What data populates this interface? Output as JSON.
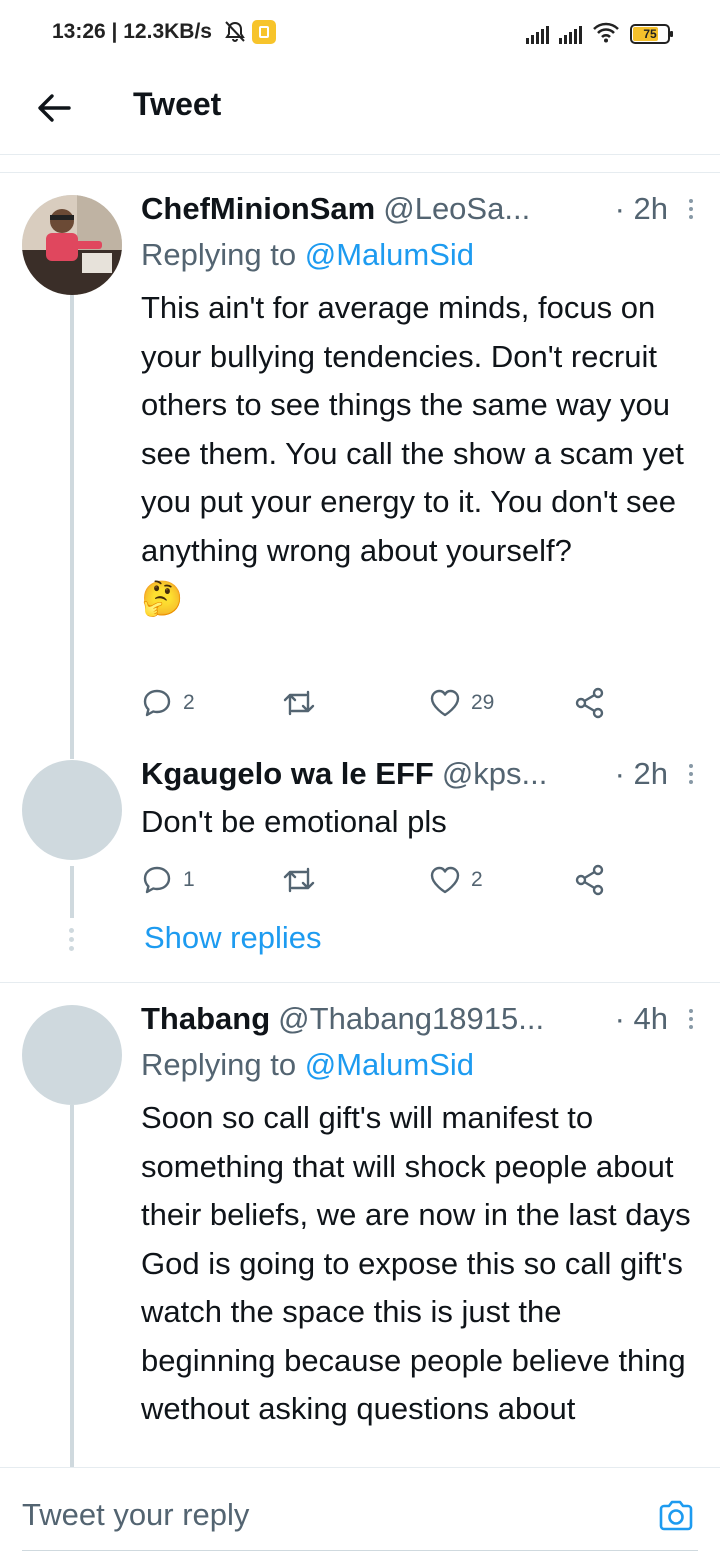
{
  "status_bar": {
    "time_speed": "13:26 | 12.3KB/s",
    "battery": "75",
    "icons": [
      "mute-icon",
      "app-notification-icon",
      "signal-icon",
      "wifi-icon",
      "battery-icon"
    ]
  },
  "header": {
    "title": "Tweet",
    "back_icon": "back-arrow-icon"
  },
  "tweets": [
    {
      "display_name": "ChefMinionSam",
      "handle": "@LeoSa...",
      "time": "· 2h",
      "replying_prefix": "Replying to",
      "replying_to": "@MalumSid",
      "text": "This ain't for average minds, focus on your bullying tendencies. Don't recruit others to see things the same way you see them. You call the show a scam yet you put your energy to it. You don't see anything wrong about yourself?",
      "emoji": "🤔",
      "replies": "2",
      "retweets": "",
      "likes": "29"
    },
    {
      "display_name": "Kgaugelo wa le EFF",
      "handle": "@kps...",
      "time": "· 2h",
      "text": "Don't be emotional pls",
      "replies": "1",
      "retweets": "",
      "likes": "2",
      "show_replies": "Show replies"
    },
    {
      "display_name": "Thabang",
      "handle": "@Thabang18915...",
      "time": "· 4h",
      "replying_prefix": "Replying to",
      "replying_to": "@MalumSid",
      "text": "Soon so call gift's will manifest to something that will shock people about their beliefs, we are now in the last days God is going to expose this so call gift's watch the space this is just the beginning because people believe thing wethout asking questions about"
    }
  ],
  "reply_bar": {
    "placeholder": "Tweet your reply",
    "camera_icon": "camera-icon"
  },
  "colors": {
    "accent": "#1d9bf0",
    "secondary_text": "#536471",
    "avatar_placeholder": "#cfd9de"
  }
}
